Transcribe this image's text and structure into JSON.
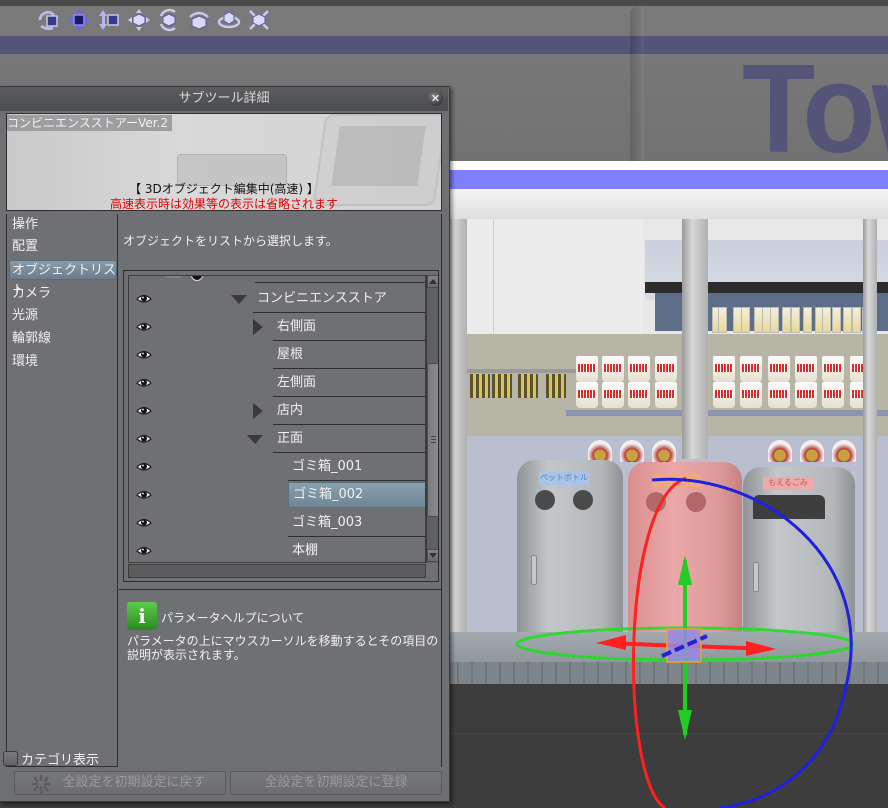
{
  "toolbar": {
    "icons": [
      {
        "name": "camera-rotate-icon"
      },
      {
        "name": "camera-pan-icon"
      },
      {
        "name": "camera-move-icon"
      },
      {
        "name": "object-move-icon"
      },
      {
        "name": "object-rotate-icon"
      },
      {
        "name": "object-rotate-horizontal-icon"
      },
      {
        "name": "object-rotate-plane-icon"
      },
      {
        "name": "object-scale-icon"
      }
    ]
  },
  "viewport": {
    "sign_text": "Tow",
    "accent_colors": {
      "sign_stripe": "#545478",
      "awning_stripe": "#7f7fff",
      "gizmo_x": "#ff2020",
      "gizmo_y": "#22cc22",
      "gizmo_z": "#2020dd"
    },
    "bins": [
      {
        "label": "ペットボトル",
        "selected": false
      },
      {
        "label": "",
        "selected": true
      },
      {
        "label": "もえるごみ",
        "selected": false
      }
    ]
  },
  "panel": {
    "title": "サブツール詳細",
    "close_label": "✕",
    "preview": {
      "name": "コンビニエンスストアーVer.2",
      "status": "【 3Dオブジェクト編集中(高速) 】",
      "warning": "高速表示時は効果等の表示は省略されます"
    },
    "categories": [
      {
        "label": "操作",
        "selected": false
      },
      {
        "label": "配置",
        "selected": false
      },
      {
        "label": "オブジェクトリスト",
        "selected": true
      },
      {
        "label": "カメラ",
        "selected": false
      },
      {
        "label": "光源",
        "selected": false
      },
      {
        "label": "輪郭線",
        "selected": false
      },
      {
        "label": "環境",
        "selected": false
      }
    ],
    "category_display": {
      "label": "カテゴリ表示",
      "checked": false
    },
    "description": "オブジェクトをリストから選択します。",
    "object_list": [
      {
        "name": "コンビニエンスストア",
        "expander": "expanded",
        "depth": 0,
        "visible": true,
        "selected": false
      },
      {
        "name": "右側面",
        "expander": "collapsed",
        "depth": 1,
        "visible": true,
        "selected": false
      },
      {
        "name": "屋根",
        "expander": "none",
        "depth": 1,
        "visible": true,
        "selected": false
      },
      {
        "name": "左側面",
        "expander": "none",
        "depth": 1,
        "visible": true,
        "selected": false
      },
      {
        "name": "店内",
        "expander": "collapsed",
        "depth": 1,
        "visible": true,
        "selected": false
      },
      {
        "name": "正面",
        "expander": "expanded",
        "depth": 1,
        "visible": true,
        "selected": false
      },
      {
        "name": "ゴミ箱_001",
        "expander": "none",
        "depth": 2,
        "visible": true,
        "selected": false
      },
      {
        "name": "ゴミ箱_002",
        "expander": "none",
        "depth": 2,
        "visible": true,
        "selected": true
      },
      {
        "name": "ゴミ箱_003",
        "expander": "none",
        "depth": 2,
        "visible": true,
        "selected": false
      },
      {
        "name": "本棚",
        "expander": "none",
        "depth": 2,
        "visible": true,
        "selected": false
      }
    ],
    "help": {
      "icon_label": "i",
      "title": "パラメータヘルプについて",
      "body": "パラメータの上にマウスカーソルを移動するとその項目の説明が表示されます。"
    },
    "buttons": {
      "reset_all": "全設定を初期設定に戻す",
      "register_all": "全設定を初期設定に登録"
    }
  }
}
